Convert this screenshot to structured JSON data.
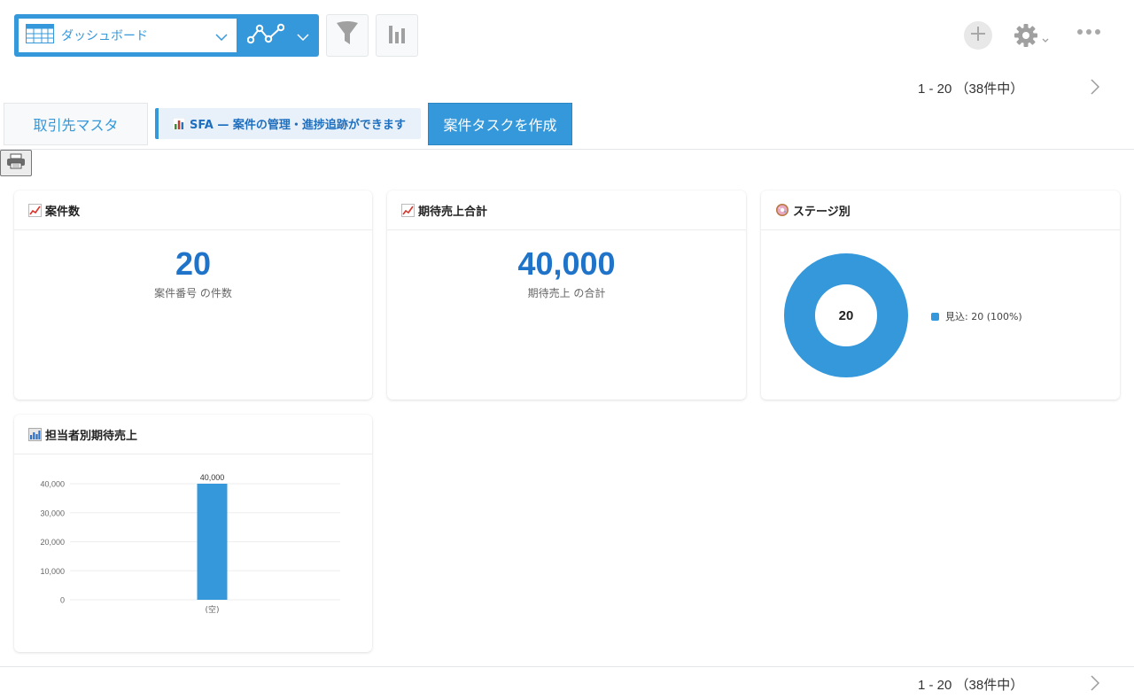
{
  "toolbar": {
    "view_label": "ダッシュボード"
  },
  "pager": {
    "range": "1 - 20",
    "count": "（38件中）"
  },
  "tabs": {
    "master": "取引先マスタ",
    "sfa": "SFA — 案件の管理・進捗追跡ができます",
    "create": "案件タスクを作成"
  },
  "cards": {
    "deals": {
      "title": "案件数",
      "value": "20",
      "label": "案件番号 の件数"
    },
    "revenue": {
      "title": "期待売上合計",
      "value": "40,000",
      "label": "期待売上 の合計"
    },
    "stage": {
      "title": "ステージ別",
      "center": "20",
      "legend": "見込: 20 (100%)"
    },
    "by_owner": {
      "title": "担当者別期待売上"
    }
  },
  "colors": {
    "accent": "#3498db",
    "number": "#1f74c9"
  },
  "chart_data": [
    {
      "type": "pie",
      "title": "ステージ別",
      "categories": [
        "見込"
      ],
      "values": [
        20
      ],
      "center_label": "20",
      "legend": [
        "見込: 20 (100%)"
      ]
    },
    {
      "type": "bar",
      "title": "担当者別期待売上",
      "categories": [
        "(空)"
      ],
      "values": [
        40000
      ],
      "data_labels": [
        "40,000"
      ],
      "ylim": [
        0,
        40000
      ],
      "yticks": [
        "0",
        "10,000",
        "20,000",
        "30,000",
        "40,000"
      ],
      "grid": true
    }
  ]
}
